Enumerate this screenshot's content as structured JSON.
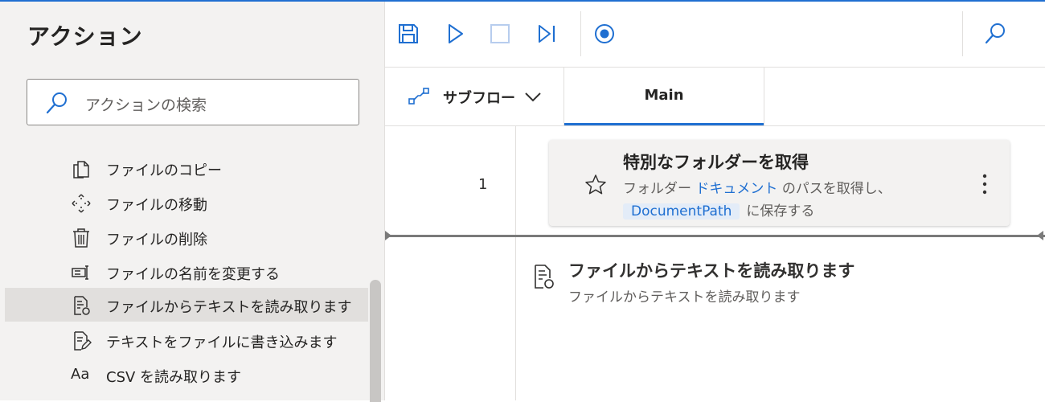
{
  "left_panel": {
    "title": "アクション",
    "search_placeholder": "アクションの検索",
    "actions": [
      {
        "label": "ファイルのコピー",
        "icon": "file-copy-icon"
      },
      {
        "label": "ファイルの移動",
        "icon": "move-icon"
      },
      {
        "label": "ファイルの削除",
        "icon": "trash-icon"
      },
      {
        "label": "ファイルの名前を変更する",
        "icon": "rename-icon"
      },
      {
        "label": "ファイルからテキストを読み取ります",
        "icon": "read-file-icon",
        "selected": true
      },
      {
        "label": "テキストをファイルに書き込みます",
        "icon": "write-file-icon"
      },
      {
        "label": "CSV を読み取ります",
        "icon": "text-font-icon",
        "icon_text": "Aa"
      }
    ]
  },
  "toolbar": {
    "buttons": [
      "save-icon",
      "run-icon",
      "stop-icon",
      "run-next-action-icon",
      "record-icon",
      "search-icon"
    ]
  },
  "tabs": {
    "subflow_label": "サブフロー",
    "main_label": "Main"
  },
  "flow": {
    "steps": [
      {
        "line_number": "1",
        "title": "特別なフォルダーを取得",
        "desc_prefix": "フォルダー",
        "desc_link": "ドキュメント",
        "desc_middle": "のパスを取得し、",
        "variable": "DocumentPath",
        "desc_suffix": "に保存する"
      }
    ],
    "drag_preview": {
      "title": "ファイルからテキストを読み取ります",
      "subtitle": "ファイルからテキストを読み取ります"
    }
  },
  "colors": {
    "accent": "#1f6fd1",
    "panel_bg": "#f3f2f1",
    "selected_bg": "#e1dfdd"
  }
}
